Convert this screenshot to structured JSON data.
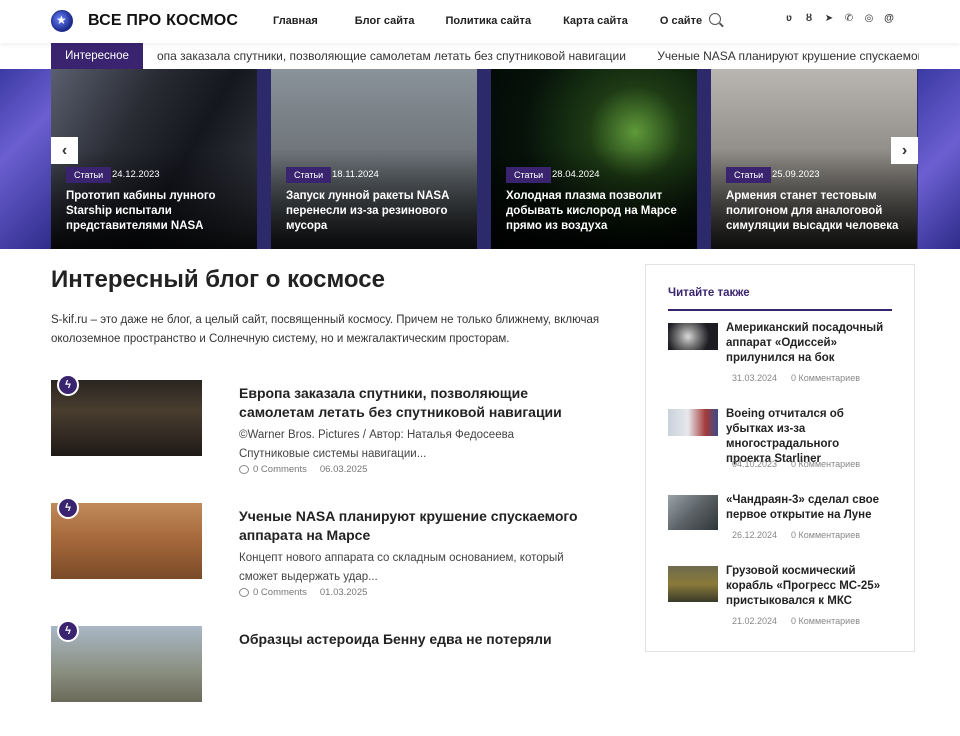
{
  "header": {
    "logo_text": "ВСЕ ПРО КОСМОС",
    "nav": [
      "Главная",
      "Блог сайта",
      "Политика сайта",
      "Карта сайта",
      "О сайте"
    ],
    "socials": [
      "вк",
      "ok",
      "tg",
      "tel",
      "wa",
      "mm"
    ]
  },
  "ticker": {
    "label": "Интересное",
    "items": [
      "опа заказала спутники, позволяющие самолетам летать без спутниковой навигации",
      "Ученые NASA планируют крушение спускаемого апп"
    ]
  },
  "slider": {
    "prev": "‹",
    "next": "›",
    "slides": [
      {
        "category": "Статьи",
        "date": "24.12.2023",
        "title": "Прототип кабины лунного Starship испытали представителями NASA"
      },
      {
        "category": "Статьи",
        "date": "18.11.2024",
        "title": "Запуск лунной ракеты NASA перенесли из-за резинового мусора"
      },
      {
        "category": "Статьи",
        "date": "28.04.2024",
        "title": "Холодная плазма позволит добывать кислород на Марсе прямо из воздуха"
      },
      {
        "category": "Статьи",
        "date": "25.09.2023",
        "title": "Армения станет тестовым полигоном для аналоговой симуляции высадки человека"
      }
    ]
  },
  "main": {
    "title": "Интересный блог о космосе",
    "description": "S-kif.ru – это даже не блог, а целый сайт, посвященный космосу. Причем не только ближнему, включая околоземное пространство и Солнечную систему, но и межгалактическим просторам.",
    "posts": [
      {
        "title": "Европа заказала спутники, позволяющие самолетам летать без спутниковой навигации",
        "excerpt": "©Warner Bros. Pictures / Автор: Наталья Федосеева Спутниковые системы навигации...",
        "comments": "0 Comments",
        "date": "06.03.2025"
      },
      {
        "title": "Ученые NASA планируют крушение спускаемого аппарата на Марсе",
        "excerpt": "Концепт нового аппарата со складным основанием, который сможет выдержать удар...",
        "comments": "0 Comments",
        "date": "01.03.2025"
      },
      {
        "title": "Образцы астероида Бенну едва не потеряли",
        "excerpt": "",
        "comments": "",
        "date": ""
      }
    ]
  },
  "sidebar": {
    "title": "Читайте также",
    "items": [
      {
        "title": "Американский посадочный аппарат «Одиссей» прилунился на бок",
        "date": "31.03.2024",
        "comments": "0 Комментариев"
      },
      {
        "title": "Boeing отчитался об убытках из-за многострадального проекта Starliner",
        "date": "04.10.2023",
        "comments": "0 Комментариев"
      },
      {
        "title": "«Чандраян-3» сделал свое первое открытие на Луне",
        "date": "26.12.2024",
        "comments": "0 Комментариев"
      },
      {
        "title": "Грузовой космический корабль «Прогресс МС-25» пристыковался к МКС",
        "date": "21.02.2024",
        "comments": "0 Комментариев"
      }
    ]
  }
}
